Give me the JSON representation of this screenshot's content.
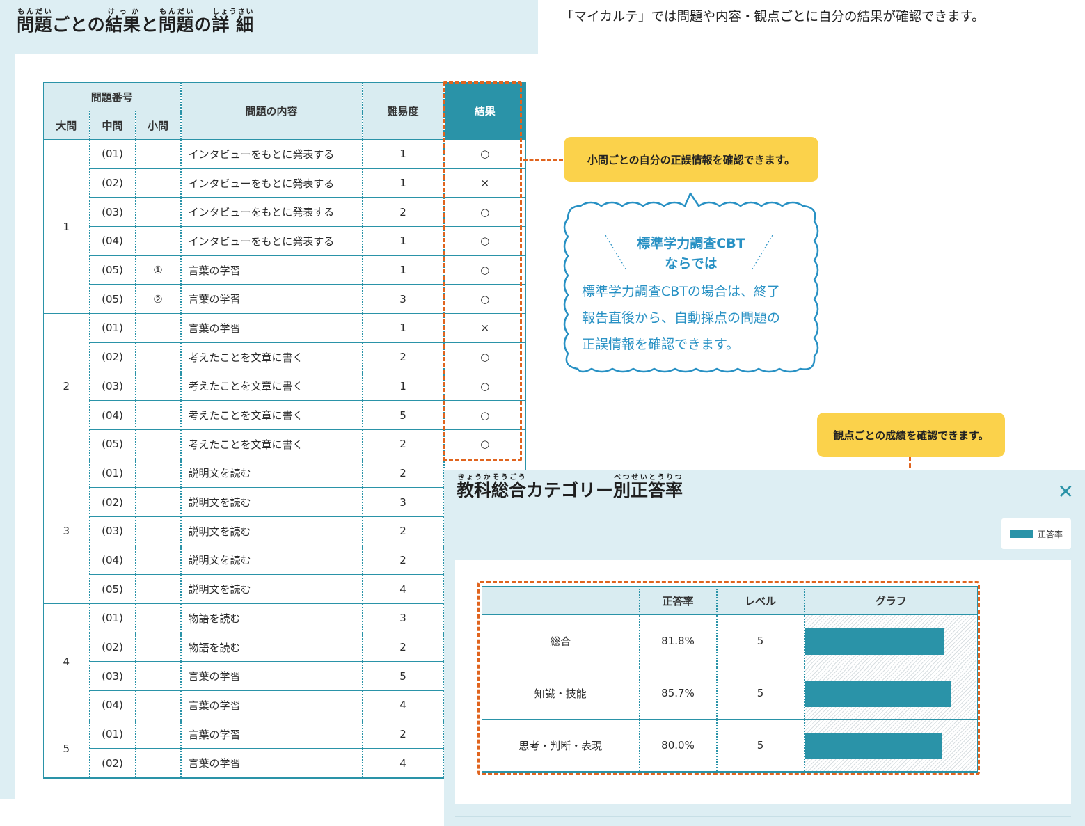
{
  "top_caption": "「マイカルテ」では問題や内容・観点ごとに自分の結果が確認できます。",
  "left": {
    "title": [
      {
        "text": "問題",
        "ruby": "もんだい"
      },
      {
        "text": "ごとの",
        "ruby": ""
      },
      {
        "text": "結果",
        "ruby": "けっか"
      },
      {
        "text": "と",
        "ruby": ""
      },
      {
        "text": "問題",
        "ruby": "もんだい"
      },
      {
        "text": "の",
        "ruby": ""
      },
      {
        "text": "詳 細",
        "ruby": "しょうさい"
      }
    ],
    "headers": {
      "number": "問題番号",
      "large": "大問",
      "medium": "中問",
      "small": "小問",
      "content": "問題の内容",
      "difficulty": "難易度",
      "result": "結果"
    },
    "groups": [
      {
        "label": "1",
        "rows": [
          {
            "mid": "(01)",
            "small": "",
            "content": "インタビューをもとに発表する",
            "diff": "1",
            "res": "○"
          },
          {
            "mid": "(02)",
            "small": "",
            "content": "インタビューをもとに発表する",
            "diff": "1",
            "res": "×"
          },
          {
            "mid": "(03)",
            "small": "",
            "content": "インタビューをもとに発表する",
            "diff": "2",
            "res": "○"
          },
          {
            "mid": "(04)",
            "small": "",
            "content": "インタビューをもとに発表する",
            "diff": "1",
            "res": "○"
          },
          {
            "mid": "(05)",
            "small": "①",
            "content": "言葉の学習",
            "diff": "1",
            "res": "○"
          },
          {
            "mid": "(05)",
            "small": "②",
            "content": "言葉の学習",
            "diff": "3",
            "res": "○"
          }
        ]
      },
      {
        "label": "2",
        "rows": [
          {
            "mid": "(01)",
            "small": "",
            "content": "言葉の学習",
            "diff": "1",
            "res": "×"
          },
          {
            "mid": "(02)",
            "small": "",
            "content": "考えたことを文章に書く",
            "diff": "2",
            "res": "○"
          },
          {
            "mid": "(03)",
            "small": "",
            "content": "考えたことを文章に書く",
            "diff": "1",
            "res": "○"
          },
          {
            "mid": "(04)",
            "small": "",
            "content": "考えたことを文章に書く",
            "diff": "5",
            "res": "○"
          },
          {
            "mid": "(05)",
            "small": "",
            "content": "考えたことを文章に書く",
            "diff": "2",
            "res": "○"
          }
        ]
      },
      {
        "label": "3",
        "rows": [
          {
            "mid": "(01)",
            "small": "",
            "content": "説明文を読む",
            "diff": "2",
            "res": ""
          },
          {
            "mid": "(02)",
            "small": "",
            "content": "説明文を読む",
            "diff": "3",
            "res": ""
          },
          {
            "mid": "(03)",
            "small": "",
            "content": "説明文を読む",
            "diff": "2",
            "res": ""
          },
          {
            "mid": "(04)",
            "small": "",
            "content": "説明文を読む",
            "diff": "2",
            "res": ""
          },
          {
            "mid": "(05)",
            "small": "",
            "content": "説明文を読む",
            "diff": "4",
            "res": ""
          }
        ]
      },
      {
        "label": "4",
        "rows": [
          {
            "mid": "(01)",
            "small": "",
            "content": "物語を読む",
            "diff": "3",
            "res": ""
          },
          {
            "mid": "(02)",
            "small": "",
            "content": "物語を読む",
            "diff": "2",
            "res": ""
          },
          {
            "mid": "(03)",
            "small": "",
            "content": "言葉の学習",
            "diff": "5",
            "res": ""
          },
          {
            "mid": "(04)",
            "small": "",
            "content": "言葉の学習",
            "diff": "4",
            "res": ""
          }
        ]
      },
      {
        "label": "5",
        "rows": [
          {
            "mid": "(01)",
            "small": "",
            "content": "言葉の学習",
            "diff": "2",
            "res": ""
          },
          {
            "mid": "(02)",
            "small": "",
            "content": "言葉の学習",
            "diff": "4",
            "res": ""
          }
        ]
      }
    ]
  },
  "callouts": {
    "small_question": "小問ごとの自分の正誤情報を確認できます。",
    "perspective": "観点ごとの成績を確認できます。"
  },
  "cloud": {
    "title_line1": "標準学力調査CBT",
    "title_line2": "ならでは",
    "body": [
      "標準学力調査CBTの場合は、終了",
      "報告直後から、自動採点の問題の",
      "正誤情報を確認できます。"
    ]
  },
  "popup": {
    "title": [
      {
        "text": "教科総合",
        "ruby": "きょうかそうごう"
      },
      {
        "text": "カテゴリー",
        "ruby": ""
      },
      {
        "text": "別",
        "ruby": "べつ"
      },
      {
        "text": "正答率",
        "ruby": "せいとうりつ"
      }
    ],
    "close_icon": "close-icon",
    "legend_label": "正答率",
    "headers": {
      "category": "",
      "rate": "正答率",
      "level": "レベル",
      "graph": "グラフ"
    },
    "rows": [
      {
        "name": "総合",
        "rate": "81.8%",
        "rate_value": 81.8,
        "level": "5"
      },
      {
        "name": "知識・技能",
        "rate": "85.7%",
        "rate_value": 85.7,
        "level": "5"
      },
      {
        "name": "思考・判断・表現",
        "rate": "80.0%",
        "rate_value": 80.0,
        "level": "5"
      }
    ]
  },
  "colors": {
    "accent": "#2a93a8",
    "highlight": "#e0641e",
    "callout": "#fbd24b",
    "cloud_text": "#2891c4",
    "panel": "#ddeef3"
  }
}
